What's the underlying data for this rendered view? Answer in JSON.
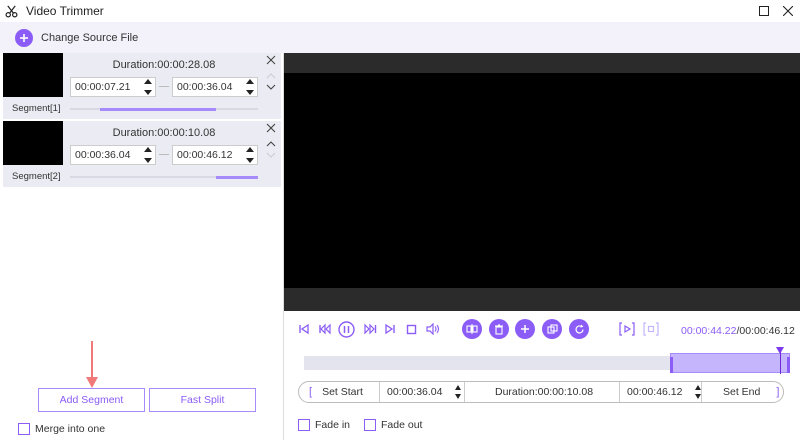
{
  "window": {
    "title": "Video Trimmer"
  },
  "source": {
    "label": "Change Source File"
  },
  "segments": [
    {
      "duration": "Duration:00:00:28.08",
      "start": "00:00:07.21",
      "end": "00:00:36.04",
      "label": "Segment[1]"
    },
    {
      "duration": "Duration:00:00:10.08",
      "start": "00:00:36.04",
      "end": "00:00:46.12",
      "label": "Segment[2]"
    }
  ],
  "buttons": {
    "add_segment": "Add Segment",
    "fast_split": "Fast Split"
  },
  "merge": {
    "label": "Merge into one"
  },
  "player": {
    "current_time": "00:00:44.22",
    "separator": "/",
    "total_time": "00:00:46.12"
  },
  "trim": {
    "set_start": "Set Start",
    "start_time": "00:00:36.04",
    "duration": "Duration:00:00:10.08",
    "end_time": "00:00:46.12",
    "set_end": "Set End",
    "bracket_open": "[",
    "bracket_close": "]"
  },
  "fade": {
    "fade_in": "Fade in",
    "fade_out": "Fade out"
  },
  "colors": {
    "accent": "#8b5cf6",
    "accent_light": "#c4b5fd"
  }
}
